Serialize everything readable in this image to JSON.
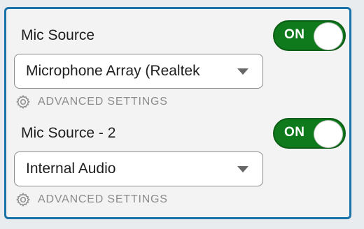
{
  "sources": [
    {
      "label": "Mic Source",
      "toggle": "ON",
      "selected": "Microphone Array (Realtek",
      "advanced": "ADVANCED SETTINGS"
    },
    {
      "label": "Mic Source - 2",
      "toggle": "ON",
      "selected": "Internal Audio",
      "advanced": "ADVANCED SETTINGS"
    }
  ],
  "colors": {
    "accent_border": "#1a73a8",
    "toggle_on": "#0f7a1c",
    "advanced_text": "#8b8b8b"
  },
  "icons": [
    "gear-icon",
    "chevron-down-icon"
  ]
}
